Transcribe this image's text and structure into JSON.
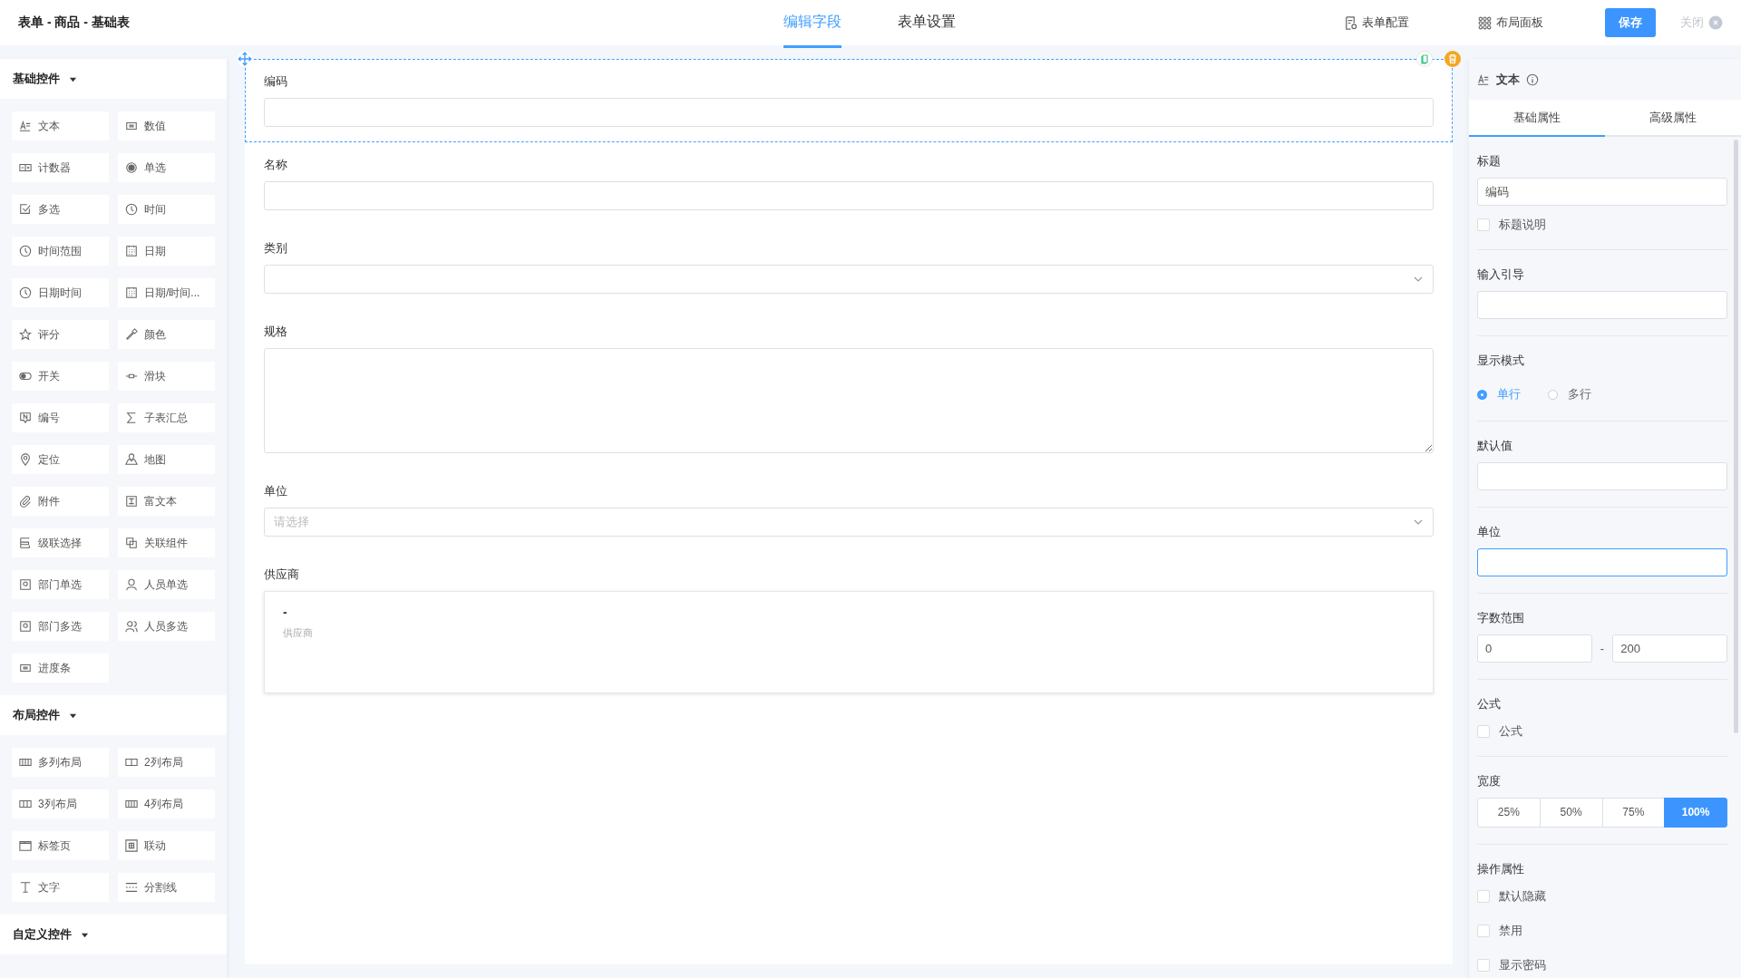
{
  "header": {
    "title": "表单 - 商品 - 基础表",
    "tabs": [
      {
        "label": "编辑字段",
        "selected": true
      },
      {
        "label": "表单设置",
        "selected": false
      }
    ],
    "actions": [
      {
        "label": "表单配置"
      },
      {
        "label": "布局面板"
      }
    ],
    "save": "保存",
    "close": "关闭"
  },
  "palette": [
    {
      "title": "基础控件",
      "expanded": true,
      "items": [
        "文本",
        "数值",
        "计数器",
        "单选",
        "多选",
        "时间",
        "时间范围",
        "日期",
        "日期时间",
        "日期/时间...",
        "评分",
        "颜色",
        "开关",
        "滑块",
        "编号",
        "子表汇总",
        "定位",
        "地图",
        "附件",
        "富文本",
        "级联选择",
        "关联组件",
        "部门单选",
        "人员单选",
        "部门多选",
        "人员多选",
        "进度条"
      ]
    },
    {
      "title": "布局控件",
      "expanded": true,
      "items": [
        "多列布局",
        "2列布局",
        "3列布局",
        "4列布局",
        "标签页",
        "联动",
        "文字",
        "分割线"
      ]
    },
    {
      "title": "自定义控件",
      "expanded": true
    }
  ],
  "canvas": {
    "fields": [
      {
        "label": "编码",
        "kind": "input",
        "selected": true
      },
      {
        "label": "名称",
        "kind": "input",
        "selected": false
      },
      {
        "label": "类别",
        "kind": "select",
        "selected": false
      },
      {
        "label": "规格",
        "kind": "textarea",
        "selected": false
      },
      {
        "label": "单位",
        "kind": "select",
        "placeholder": "请选择",
        "selected": false
      },
      {
        "label": "供应商",
        "kind": "supplier",
        "value": "-",
        "hint": "供应商",
        "selected": false
      }
    ]
  },
  "props": {
    "title": "文本",
    "tabs": [
      {
        "label": "基础属性",
        "selected": true
      },
      {
        "label": "高级属性",
        "selected": false
      }
    ],
    "sections": [
      {
        "kind": "input",
        "label": "标题",
        "value": "编码",
        "focused": false,
        "checks": [
          {
            "label": "标题说明",
            "checked": false
          }
        ]
      },
      {
        "kind": "input",
        "label": "输入引导",
        "focused": false
      },
      {
        "kind": "radio",
        "label": "显示模式",
        "options": [
          {
            "label": "单行",
            "selected": true
          },
          {
            "label": "多行",
            "selected": false
          }
        ]
      },
      {
        "kind": "input",
        "label": "默认值",
        "focused": false
      },
      {
        "kind": "input",
        "label": "单位",
        "focused": true
      },
      {
        "kind": "range",
        "label": "字数范围",
        "min": "0",
        "separator": "-",
        "max": "200"
      },
      {
        "kind": "checks",
        "label": "公式",
        "checks": [
          {
            "label": "公式",
            "checked": false
          }
        ]
      },
      {
        "kind": "segments",
        "label": "宽度",
        "options": [
          {
            "label": "25%",
            "selected": false
          },
          {
            "label": "50%",
            "selected": false
          },
          {
            "label": "75%",
            "selected": false
          },
          {
            "label": "100%",
            "selected": true
          }
        ]
      },
      {
        "kind": "checks",
        "label": "操作属性",
        "checks": [
          {
            "label": "默认隐藏",
            "checked": false
          },
          {
            "label": "禁用",
            "checked": false
          },
          {
            "label": "显示密码",
            "checked": false
          }
        ]
      }
    ]
  }
}
